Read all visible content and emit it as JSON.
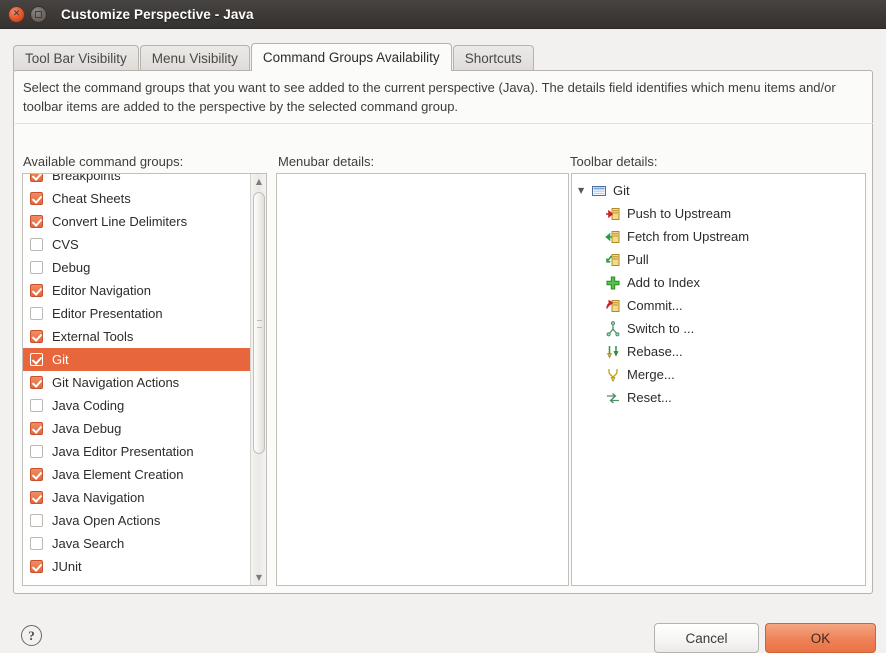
{
  "window": {
    "title": "Customize Perspective - Java",
    "close_icon": "close-icon",
    "maximize_icon": "maximize-icon"
  },
  "tabs": [
    {
      "label": "Tool Bar Visibility",
      "active": false
    },
    {
      "label": "Menu Visibility",
      "active": false
    },
    {
      "label": "Command Groups Availability",
      "active": true
    },
    {
      "label": "Shortcuts",
      "active": false
    }
  ],
  "description": "Select the command groups that you want to see added to the current perspective (Java).  The details field identifies which menu items and/or toolbar items are added to the perspective by the selected command group.",
  "columns": {
    "available": "Available command groups:",
    "menubar": "Menubar details:",
    "toolbar": "Toolbar details:"
  },
  "command_groups": [
    {
      "label": "Breakpoints",
      "checked": true,
      "selected": false
    },
    {
      "label": "Cheat Sheets",
      "checked": true,
      "selected": false
    },
    {
      "label": "Convert Line Delimiters",
      "checked": true,
      "selected": false
    },
    {
      "label": "CVS",
      "checked": false,
      "selected": false
    },
    {
      "label": "Debug",
      "checked": false,
      "selected": false
    },
    {
      "label": "Editor Navigation",
      "checked": true,
      "selected": false
    },
    {
      "label": "Editor Presentation",
      "checked": false,
      "selected": false
    },
    {
      "label": "External Tools",
      "checked": true,
      "selected": false
    },
    {
      "label": "Git",
      "checked": true,
      "selected": true
    },
    {
      "label": "Git Navigation Actions",
      "checked": true,
      "selected": false
    },
    {
      "label": "Java Coding",
      "checked": false,
      "selected": false
    },
    {
      "label": "Java Debug",
      "checked": true,
      "selected": false
    },
    {
      "label": "Java Editor Presentation",
      "checked": false,
      "selected": false
    },
    {
      "label": "Java Element Creation",
      "checked": true,
      "selected": false
    },
    {
      "label": "Java Navigation",
      "checked": true,
      "selected": false
    },
    {
      "label": "Java Open Actions",
      "checked": false,
      "selected": false
    },
    {
      "label": "Java Search",
      "checked": false,
      "selected": false
    },
    {
      "label": "JUnit",
      "checked": true,
      "selected": false
    }
  ],
  "menubar_details": [],
  "toolbar_details": {
    "root": {
      "label": "Git",
      "icon": "toolbar-icon",
      "expanded": true,
      "twisty": "▼"
    },
    "children": [
      {
        "label": "Push to Upstream",
        "icon": "push-to-upstream-icon"
      },
      {
        "label": "Fetch from Upstream",
        "icon": "fetch-from-upstream-icon"
      },
      {
        "label": "Pull",
        "icon": "pull-icon"
      },
      {
        "label": "Add to Index",
        "icon": "add-to-index-icon"
      },
      {
        "label": "Commit...",
        "icon": "commit-icon"
      },
      {
        "label": "Switch to ...",
        "icon": "switch-to-icon"
      },
      {
        "label": "Rebase...",
        "icon": "rebase-icon"
      },
      {
        "label": "Merge...",
        "icon": "merge-icon"
      },
      {
        "label": "Reset...",
        "icon": "reset-icon"
      }
    ]
  },
  "footer": {
    "help_glyph": "?",
    "cancel_label": "Cancel",
    "ok_label": "OK"
  },
  "scrollbar": {
    "up_glyph": "▲",
    "down_glyph": "▼"
  },
  "colors": {
    "selection": "#e8663c",
    "ok_button": "#ee8257",
    "titlebar": "#3d3a38"
  }
}
